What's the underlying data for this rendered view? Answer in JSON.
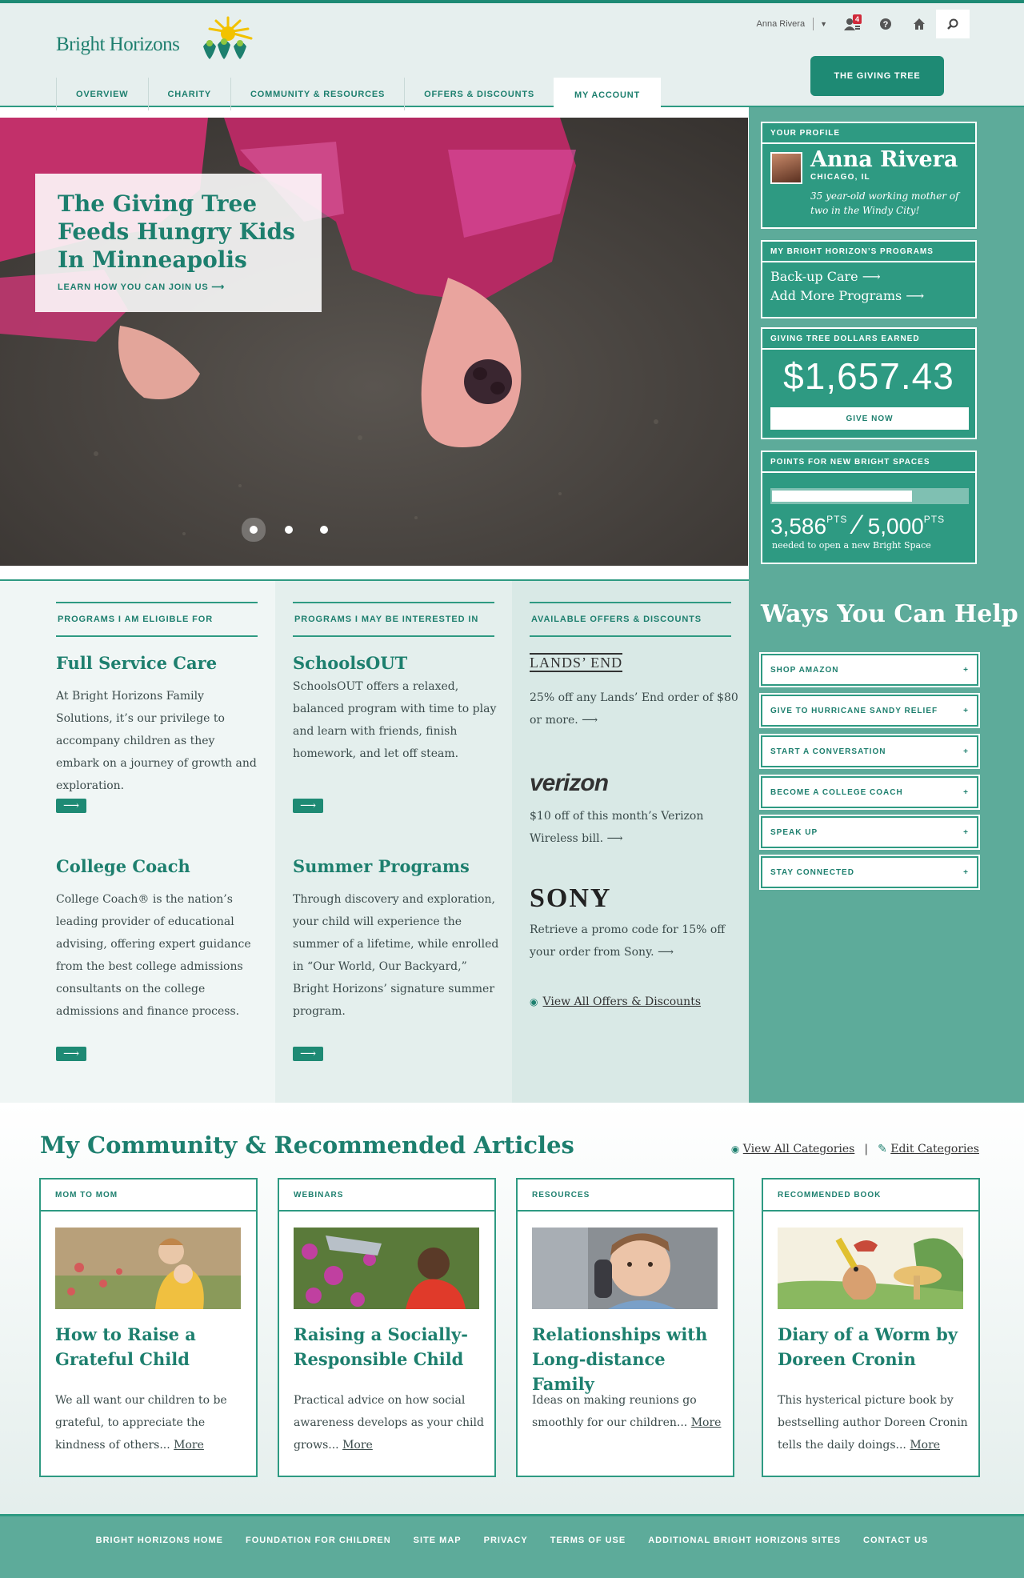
{
  "header": {
    "logo": "Bright Horizons",
    "user_name": "Anna Rivera",
    "notif_count": "4",
    "giving_tree_btn": "THE GIVING TREE"
  },
  "nav": {
    "tabs": [
      {
        "label": "OVERVIEW"
      },
      {
        "label": "CHARITY"
      },
      {
        "label": "COMMUNITY & RESOURCES"
      },
      {
        "label": "OFFERS & DISCOUNTS"
      },
      {
        "label": "MY ACCOUNT"
      }
    ]
  },
  "hero": {
    "title": "The Giving Tree Feeds Hungry Kids In Minneapolis",
    "link": "LEARN HOW YOU CAN JOIN US ⟶"
  },
  "profile": {
    "heading": "YOUR PROFILE",
    "name": "Anna Rivera",
    "city": "CHICAGO, IL",
    "desc": "35 year-old working mother of two in the Windy City!"
  },
  "programs_box": {
    "heading": "MY BRIGHT HORIZON’S PROGRAMS",
    "links": [
      "Back-up Care ⟶",
      "Add More Programs ⟶"
    ]
  },
  "dollars_box": {
    "heading": "GIVING TREE DOLLARS EARNED",
    "amount": "$1,657.43",
    "button": "GIVE NOW"
  },
  "points_box": {
    "heading": "POINTS FOR NEW BRIGHT SPACES",
    "current": "3,586",
    "goal": "5,000",
    "unit": "PTS",
    "progress": 0.717,
    "sub": "needed to open a new Bright Space"
  },
  "ways": {
    "title": "Ways You Can Help",
    "items": [
      {
        "label": "SHOP AMAZON"
      },
      {
        "label": "GIVE TO HURRICANE SANDY RELIEF"
      },
      {
        "label": "START A CONVERSATION"
      },
      {
        "label": "BECOME A COLLEGE COACH"
      },
      {
        "label": "SPEAK UP"
      },
      {
        "label": "STAY CONNECTED"
      }
    ],
    "plus": "+"
  },
  "eligible": {
    "heading": "PROGRAMS I AM ELIGIBLE FOR",
    "items": [
      {
        "title": "Full Service Care",
        "text": "At Bright Horizons Family Solutions, it’s our privilege to accompany children as they embark on a journey of growth and exploration."
      },
      {
        "title": "College Coach",
        "text": "College Coach® is the nation’s leading provider of educational advising, offering expert guidance from the best college admissions consultants on the college admissions and finance process."
      }
    ]
  },
  "interested": {
    "heading": "PROGRAMS I MAY BE INTERESTED IN",
    "items": [
      {
        "title": "SchoolsOUT",
        "text": "SchoolsOUT offers a relaxed, balanced program with time to play and learn with friends, finish homework, and let off steam."
      },
      {
        "title": "Summer Programs",
        "text": "Through discovery and exploration, your child will experience the summer of a lifetime, while enrolled in “Our World, Our Backyard,” Bright Horizons’ signature summer program."
      }
    ]
  },
  "offers": {
    "heading": "AVAILABLE OFFERS & DISCOUNTS",
    "items": [
      {
        "brand": "LANDS’ END",
        "text": "25% off any Lands’ End order of $80 or more. ⟶"
      },
      {
        "brand": "verizon",
        "text": "$10 off of this month’s Verizon Wireless bill. ⟶"
      },
      {
        "brand": "SONY",
        "text": "Retrieve a promo code for 15% off your order from Sony.  ⟶"
      }
    ],
    "view_all": "View All Offers & Discounts"
  },
  "arrow": "⟶",
  "community": {
    "title": "My Community & Recommended Articles",
    "view_all": "View All Categories",
    "divider": "|",
    "edit": "Edit Categories",
    "cards": [
      {
        "category": "MOM TO MOM",
        "title": "How to Raise a Grateful Child",
        "text": "We all want our children to be grateful, to appreciate the kindness of others...",
        "more": "More"
      },
      {
        "category": "WEBINARS",
        "title": "Raising a Socially-Responsible Child",
        "text": "Practical advice on how social awareness develops as your child grows...",
        "more": "More"
      },
      {
        "category": "RESOURCES",
        "title": "Relationships with Long-distance Family",
        "text": "Ideas on making reunions go smoothly for our children...",
        "more": "More"
      },
      {
        "category": "RECOMMENDED BOOK",
        "title": "Diary of a Worm by Doreen Cronin",
        "text": "This hysterical picture book by bestselling author Doreen Cronin tells the daily doings...",
        "more": "More"
      }
    ]
  },
  "footer": {
    "links": [
      "BRIGHT HORIZONS HOME",
      "FOUNDATION FOR CHILDREN",
      "SITE MAP",
      "PRIVACY",
      "TERMS OF USE",
      "ADDITIONAL BRIGHT HORIZONS SITES",
      "CONTACT US"
    ]
  },
  "colors": {
    "brand": "#1d7f6e",
    "accent": "#2e9a82",
    "sidebar": "#5dab9a",
    "badge": "#d02a3a"
  }
}
